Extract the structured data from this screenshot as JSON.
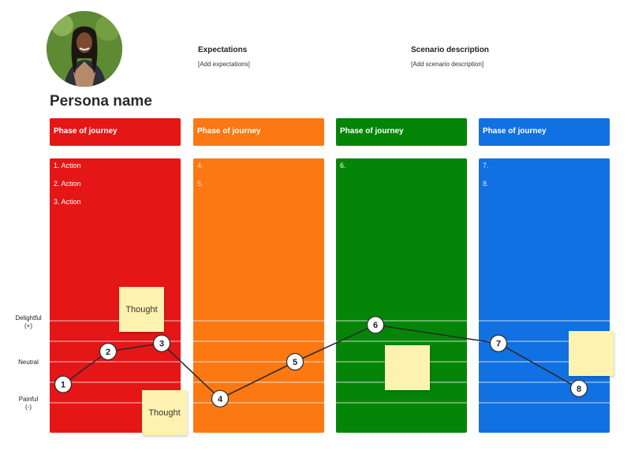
{
  "header": {
    "expectations_label": "Expectations",
    "expectations_value": "[Add expectations]",
    "scenario_label": "Scenario description",
    "scenario_value": "[Add scenario description]"
  },
  "persona": {
    "name": "Persona name"
  },
  "phases": [
    {
      "title": "Phase of journey",
      "color": "#e41616",
      "actions": [
        "1. Action",
        "2. Action",
        "3. Action"
      ]
    },
    {
      "title": "Phase of journey",
      "color": "#fb7813",
      "actions": [
        "4.",
        "5."
      ]
    },
    {
      "title": "Phase of journey",
      "color": "#048507",
      "actions": [
        "6."
      ]
    },
    {
      "title": "Phase of journey",
      "color": "#1170e2",
      "actions": [
        "7.",
        "8."
      ]
    }
  ],
  "emotion_scale": {
    "delightful_label": "Delightful\n(+)",
    "neutral_label": "Neutral",
    "painful_label": "Painful\n(-)"
  },
  "sticky_notes": [
    {
      "text": "Thought"
    },
    {
      "text": "Thought"
    },
    {
      "text": ""
    },
    {
      "text": ""
    }
  ],
  "journey_points": [
    {
      "label": "1",
      "phase": 1,
      "emotion": -1.1
    },
    {
      "label": "2",
      "phase": 1,
      "emotion": 0.5
    },
    {
      "label": "3",
      "phase": 1,
      "emotion": 0.9
    },
    {
      "label": "4",
      "phase": 2,
      "emotion": -1.8
    },
    {
      "label": "5",
      "phase": 2,
      "emotion": 0.0
    },
    {
      "label": "6",
      "phase": 3,
      "emotion": 1.8
    },
    {
      "label": "7",
      "phase": 4,
      "emotion": 0.9
    },
    {
      "label": "8",
      "phase": 4,
      "emotion": -1.3
    }
  ]
}
